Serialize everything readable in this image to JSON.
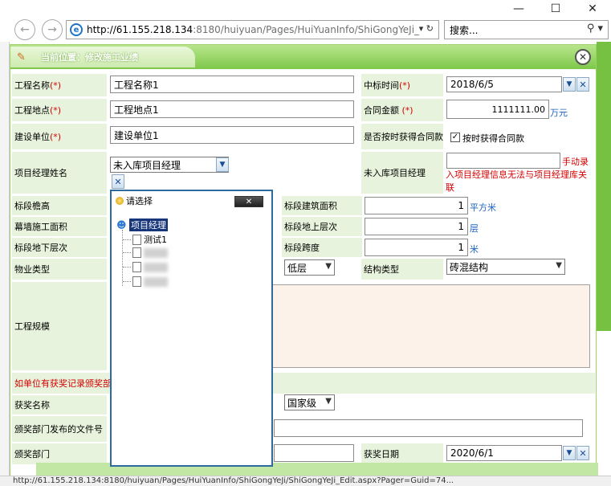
{
  "browser": {
    "url_host": "http://61.155.218.134",
    "url_path": ":8180/huiyuan/Pages/HuiYuanInfo/ShiGongYeJi_",
    "url_controls": "▾ ↻",
    "search_placeholder": "搜索...",
    "window_controls": [
      "—",
      "☐",
      "✕"
    ]
  },
  "panel": {
    "breadcrumb": "当前位置：修改施工业绩"
  },
  "form": {
    "project_name_label": "工程名称",
    "project_name_value": "工程名称1",
    "project_location_label": "工程地点",
    "project_location_value": "工程地点1",
    "builder_label": "建设单位",
    "builder_value": "建设单位1",
    "required_mark": "(*)",
    "bid_time_label": "中标时间",
    "bid_time_value": "2018/6/5",
    "contract_amount_label": "合同金额",
    "contract_amount_value": "1111111.00",
    "contract_amount_unit": "万元",
    "on_time_label": "是否按时获得合同款",
    "on_time_checkbox_label": "按时获得合同款",
    "on_time_checked": true,
    "pm_name_label": "项目经理姓名",
    "pm_name_value": "未入库项目经理",
    "pm_unregistered_label": "未入库项目经理",
    "pm_unregistered_value": "",
    "pm_note": "手动录入项目经理信息无法与项目经理库关联",
    "height_label": "标段檐高",
    "area_label": "标段建筑面积",
    "area_value": "1",
    "area_unit": "平方米",
    "curtain_label": "幕墙施工面积",
    "above_floors_label": "标段地上层次",
    "above_floors_value": "1",
    "above_floors_unit": "层",
    "below_floors_label": "标段地下层次",
    "span_label": "标段跨度",
    "span_value": "1",
    "span_unit": "米",
    "property_label": "物业类型",
    "floor_type_value": "低层",
    "structure_label": "结构类型",
    "structure_value": "砖混结构",
    "scale_label": "工程规模",
    "award_note": "如单位有获奖记录颁奖部",
    "award_name_label": "获奖名称",
    "award_level_value": "国家级",
    "award_doc_label": "颁奖部门发布的文件号",
    "award_dept_label": "颁奖部门",
    "award_date_label": "获奖日期",
    "award_date_value": "2020/6/1"
  },
  "popup": {
    "title": "请选择",
    "close_label": "✕",
    "root_label": "项目经理",
    "items": [
      "测试1"
    ]
  },
  "statusbar": {
    "text": "http://61.155.218.134:8180/huiyuan/Pages/HuiYuanInfo/ShiGongYeJi/ShiGongYeJi_Edit.aspx?Pager=Guid=74..."
  }
}
